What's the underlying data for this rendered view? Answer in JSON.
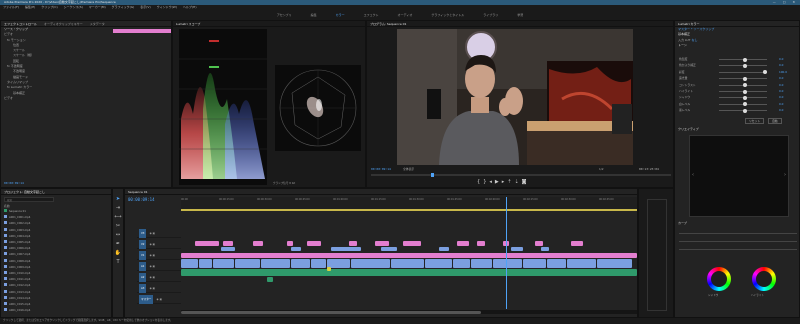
{
  "app": {
    "window_title": "Adobe Premiere Pro 2020 - D:\\Video\\自動文字起こし\\Premiere Pro\\Sequence",
    "window_controls": "—  □  ✕"
  },
  "menu": [
    "ファイル(F)",
    "編集(E)",
    "クリップ(C)",
    "シーケンス(S)",
    "マーカー(M)",
    "グラフィック(G)",
    "表示(V)",
    "ウィンドウ(W)",
    "ヘルプ(H)"
  ],
  "workspaces": [
    "アセンブリ",
    "編集",
    "カラー",
    "エフェクト",
    "オーディオ",
    "グラフィックとタイトル",
    "ライブラリ",
    "学習"
  ],
  "workspace_active": "カラー",
  "left_panel": {
    "tabs": [
      "エフェクトコントロール",
      "オーディオクリップミキサー",
      "メタデータ"
    ],
    "clip_label": "ソース・クリップ",
    "rows": [
      "ビデオ",
      "fx モーション",
      "位置",
      "スケール",
      "スケール（幅）",
      "回転",
      "fx 不透明度",
      "不透明度",
      "描画モード",
      "タイムリマップ",
      "fx Lumetri カラー",
      "基本補正",
      "ビデオ"
    ],
    "timecode": "00:00:09:14"
  },
  "scopes": {
    "tab": "Lumetri スコープ",
    "waveform_label": "RGB パレード",
    "vectorscope_label": "ベクトルスコープ YUV",
    "bottom_controls": "クランプ信号  8 bit"
  },
  "program": {
    "tab": "プログラム: Sequence 01",
    "timecode_left": "00:00:09:14",
    "fit": "全体表示",
    "quality": "1/2",
    "timecode_right": "00:13:23:04"
  },
  "lumetri": {
    "tab": "Lumetri カラー",
    "source_label": "マスター * ソースクリップ",
    "section_basic": "基本補正",
    "input_lut": "入力 LUT",
    "lut_value": "なし",
    "section_tone": "トーン",
    "rows": [
      "色温度",
      "色かぶり補正",
      "彩度",
      "露光量",
      "コントラスト",
      "ハイライト",
      "シャドウ",
      "白レベル",
      "黒レベル"
    ],
    "values": [
      "0.0",
      "0.0",
      "100.0",
      "0.0",
      "0.0",
      "0.0",
      "0.0",
      "0.0",
      "0.0"
    ],
    "reset_label": "リセット",
    "auto_label": "自動",
    "section_creative": "クリエイティブ",
    "section_curves": "カーブ",
    "wheel_shadow_label": "シャドウ",
    "wheel_highlight_label": "ハイライト"
  },
  "project": {
    "tab": "プロジェクト: 自動文字起こし",
    "search_placeholder": "検索",
    "header": "名前",
    "items": [
      "Sequence 01",
      "A001_C001.mp4",
      "A001_C002.mp4",
      "A001_C003.mp4",
      "A001_C004.mp4",
      "A001_C005.mp4",
      "A001_C006.mp4",
      "A001_C007.mp4",
      "A001_C008.mp4",
      "A001_C009.mp4",
      "A001_C010.mp4",
      "A001_C011.mp4",
      "A001_C012.mp4",
      "A001_C013.mp4",
      "A001_C014.mp4",
      "A001_C015.mp4",
      "A001_C016.mp4"
    ]
  },
  "timeline": {
    "tab": "Sequence 01",
    "timecode": "00:00:09:14",
    "tracks": [
      "V3",
      "V2",
      "V1",
      "A1",
      "A2",
      "A3",
      "マスター"
    ],
    "ruler_labels": [
      "00:00",
      "00:00:15:00",
      "00:00:30:00",
      "00:00:45:00",
      "00:01:00:00",
      "00:01:15:00",
      "00:01:30:00",
      "00:01:45:00",
      "00:02:00:00",
      "00:02:15:00",
      "00:02:30:00",
      "00:02:45:00"
    ]
  },
  "status_bar": "クリックして選択、または空のエリアをクリックしてドラッグで範囲選択します。Shift、Alt、Ctrl キーを使用して他のオプションを表示します。",
  "colors": {
    "accent": "#4fa3f7",
    "clip_pink": "#e37ecf",
    "clip_blue": "#7b9fe0",
    "clip_green": "#2f9a6b",
    "title_blue": "#2b5a7a"
  }
}
